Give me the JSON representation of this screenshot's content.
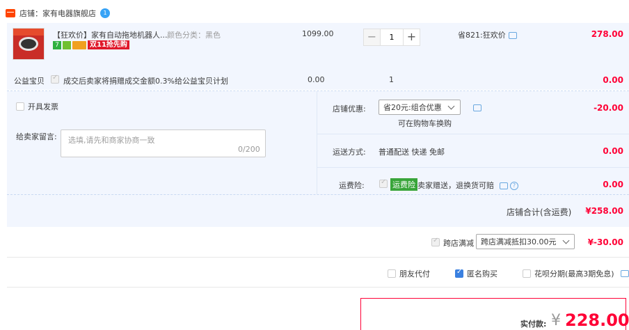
{
  "shop": {
    "label": "店铺：家有电器旗舰店",
    "badge": "1"
  },
  "item": {
    "title": "【狂欢价】家有自动拖地机器人...",
    "sku": "颜色分类：黑色",
    "badge_7": "7",
    "badge_promo": "双11抢先购",
    "unit_price": "1099.00",
    "quantity": "1",
    "decrease": "−",
    "increase": "+",
    "discount": "省821:狂欢价",
    "subtotal": "278.00"
  },
  "charity": {
    "label": "公益宝贝",
    "text": "成交后卖家将捐赠成交金额0.3%给公益宝贝计划",
    "price": "0.00",
    "qty": "1",
    "subtotal": "0.00"
  },
  "invoice": {
    "label": "开具发票"
  },
  "message": {
    "label": "给卖家留言:",
    "placeholder": "选填,请先和商家协商一致",
    "count": "0/200"
  },
  "shop_discount": {
    "label": "店铺优惠:",
    "selected": "省20元:组合优惠",
    "note": "可在购物车换购",
    "value": "-20.00"
  },
  "shipping": {
    "label": "运送方式:",
    "text": "普通配送 快递 免邮",
    "value": "0.00"
  },
  "insurance": {
    "label": "运费险:",
    "tag": "运费险",
    "text": "卖家赠送，退换货可赔",
    "value": "0.00"
  },
  "shop_total": {
    "label": "店铺合计(含运费)",
    "value": "¥258.00"
  },
  "cross_store": {
    "label": "跨店满减",
    "selected": "跨店满减抵扣30.00元",
    "value": "¥-30.00"
  },
  "pay_options": [
    {
      "label": "朋友代付",
      "checked": false
    },
    {
      "label": "匿名购买",
      "checked": true
    },
    {
      "label": "花呗分期(最高3期免息)",
      "checked": false
    }
  ],
  "total": {
    "label": "实付款:",
    "currency": "¥",
    "value": "228.00"
  },
  "colors": {
    "accent": "#ff0036",
    "panel": "#f2f6fe",
    "link": "#3a80e0"
  }
}
